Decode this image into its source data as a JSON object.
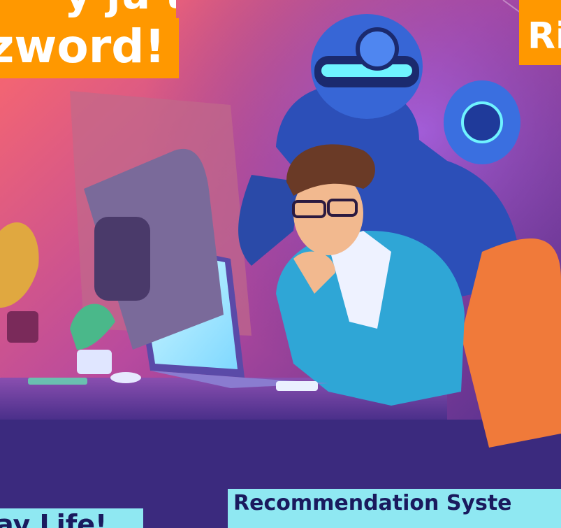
{
  "banners": {
    "top_left_fragment": "y ju t",
    "top_left_main": "zword!",
    "top_right": "Ri",
    "bottom_left": "ay Life!",
    "bottom_right": "Recommendation Syste"
  },
  "colors": {
    "banner_orange": "#ff9800",
    "banner_cyan": "#8fe8f2",
    "banner_text_dark": "#1a1a5e",
    "background_purple": "#3a2a8c"
  }
}
